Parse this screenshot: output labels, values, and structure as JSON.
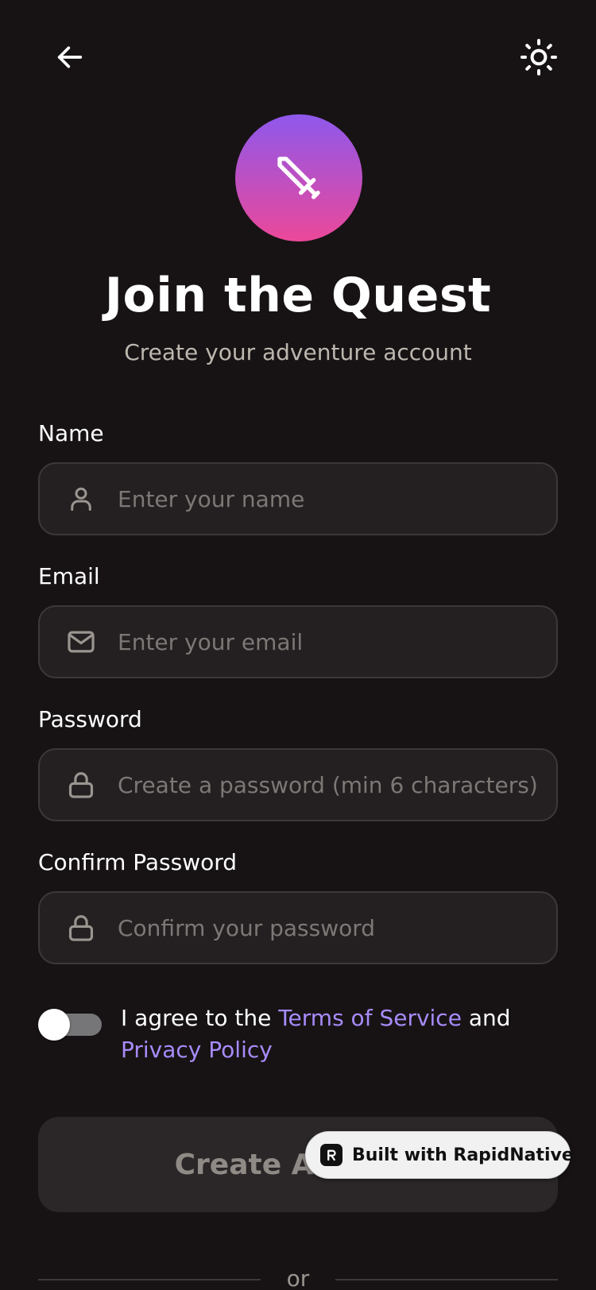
{
  "header": {
    "back_icon": "arrow-left-icon",
    "theme_icon": "sun-icon"
  },
  "logo": {
    "icon": "sword-icon",
    "gradient_start": "#8E58EC",
    "gradient_end": "#EC4899"
  },
  "title": "Join the Quest",
  "subtitle": "Create your adventure account",
  "form": {
    "name": {
      "label": "Name",
      "placeholder": "Enter your name",
      "value": "",
      "icon": "user-icon"
    },
    "email": {
      "label": "Email",
      "placeholder": "Enter your email",
      "value": "",
      "icon": "mail-icon"
    },
    "password": {
      "label": "Password",
      "placeholder": "Create a password (min 6 characters)",
      "value": "",
      "icon": "lock-icon"
    },
    "confirm_password": {
      "label": "Confirm Password",
      "placeholder": "Confirm your password",
      "value": "",
      "icon": "lock-icon"
    }
  },
  "agreement": {
    "checked": false,
    "prefix": "I agree to the ",
    "terms_link": "Terms of Service",
    "middle": " and ",
    "privacy_link": "Privacy Policy"
  },
  "create_button": {
    "label": "Create Account"
  },
  "badge": {
    "label": "Built with RapidNative"
  },
  "divider": {
    "text": "or"
  },
  "colors": {
    "background": "#171314",
    "input_background": "#242021",
    "input_border": "#3C3839",
    "link": "#A78BFA",
    "subtitle": "#BDB7AF",
    "button_disabled": "#2B2728"
  }
}
